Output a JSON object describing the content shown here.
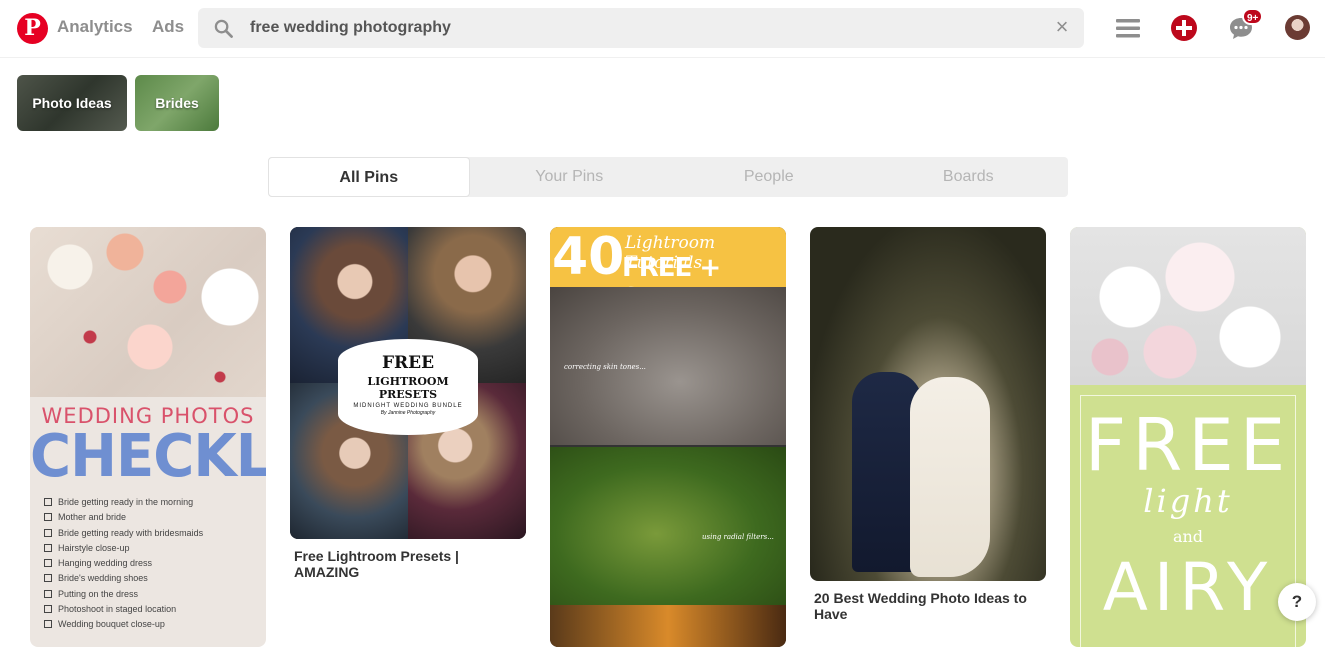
{
  "header": {
    "logo_letter": "P",
    "nav": [
      "Analytics",
      "Ads"
    ],
    "search_value": "free wedding photography",
    "clear_glyph": "×",
    "notification_badge": "9+"
  },
  "guides": [
    "Photo Ideas",
    "Brides"
  ],
  "tabs": [
    "All Pins",
    "Your Pins",
    "People",
    "Boards"
  ],
  "pins": {
    "checklist": {
      "heading": "WEDDING PHOTOS",
      "subheading": "CHECKLIST",
      "items": [
        "Bride getting ready in the morning",
        "Mother and bride",
        "Bride getting ready with bridesmaids",
        "Hairstyle close-up",
        "Hanging wedding dress",
        "Bride's wedding shoes",
        "Putting on the dress",
        "Photoshoot in staged location",
        "Wedding bouquet close-up"
      ]
    },
    "presets": {
      "line1": "FREE",
      "line2": "LIGHTROOM PRESETS",
      "line3": "MIDNIGHT WEDDING BUNDLE",
      "line4": "By Jannine Photography",
      "title": "Free Lightroom Presets | AMAZING"
    },
    "tutorials": {
      "number": "40",
      "line1": "Lightroom Tutorials",
      "line2": "FREE + SIMPLE",
      "caption1": "correcting skin tones...",
      "caption2": "using radial filters..."
    },
    "couple": {
      "title": "20 Best Wedding Photo Ideas to Have"
    },
    "airy": {
      "free": "FREE",
      "light": "light",
      "and": "and",
      "airy": "AIRY"
    }
  },
  "help": "?",
  "colors": {
    "brand": "#e60023",
    "badge": "#bd081c",
    "tab_inactive": "#b5b5b5"
  }
}
